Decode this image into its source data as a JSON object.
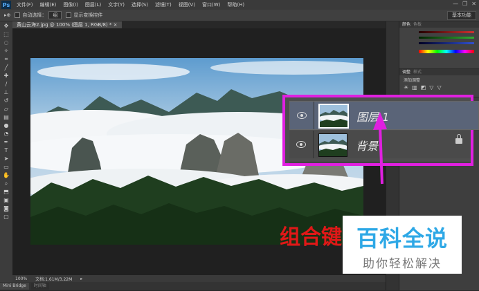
{
  "app": {
    "logo": "Ps"
  },
  "menu": {
    "items": [
      "文件(F)",
      "编辑(E)",
      "图像(I)",
      "图层(L)",
      "文字(Y)",
      "选择(S)",
      "滤镜(T)",
      "视图(V)",
      "窗口(W)",
      "帮助(H)"
    ]
  },
  "window_controls": {
    "minimize": "—",
    "restore": "❐",
    "close": "✕"
  },
  "options_bar": {
    "tool_icon": "▸⊕",
    "auto_select_label": "自动选择：",
    "auto_select_value": "组",
    "show_transform_label": "显示变换控件",
    "workspace": "基本功能"
  },
  "document": {
    "tab_title": "黄山云海2.jpg @ 100% (图层 1, RGB/8) *  ×"
  },
  "status_bar": {
    "zoom": "100%",
    "doc_info": "文档:1.61M/3.22M",
    "arrow": "▸"
  },
  "bottom_tabs": [
    "Mini Bridge",
    "时间轴"
  ],
  "panels": {
    "color": {
      "tabs": [
        "颜色",
        "色板"
      ]
    },
    "adjust": {
      "tabs": [
        "调整",
        "样式"
      ],
      "label": "添加调整",
      "icons": [
        "☀",
        "▥",
        "◩",
        "▽",
        "▽"
      ]
    },
    "colors": {
      "red": "#d03030",
      "green": "#30b030",
      "blue": "#3050d0",
      "magenta": "#e020e0",
      "text_red": "#e01818",
      "watermark_blue": "#2ea8e6"
    }
  },
  "layers": [
    {
      "name": "图层 1",
      "selected": true,
      "locked": false
    },
    {
      "name": "背景",
      "selected": false,
      "locked": true
    }
  ],
  "overlay": {
    "combo_text": "组合键"
  },
  "watermark": {
    "title": "百科全说",
    "subtitle": "助你轻松解决"
  }
}
